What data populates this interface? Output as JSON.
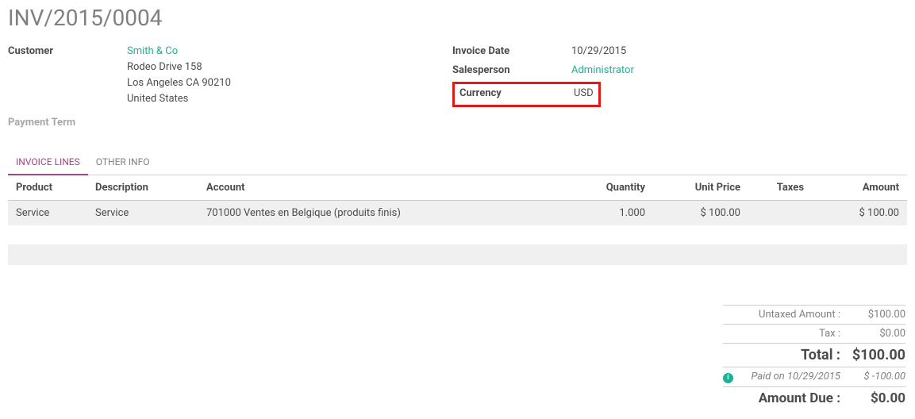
{
  "title": "INV/2015/0004",
  "left": {
    "customer_label": "Customer",
    "customer_name": "Smith & Co",
    "addr1": "Rodeo Drive 158",
    "addr2": "Los Angeles CA 90210",
    "addr3": "United States",
    "payment_term_label": "Payment Term"
  },
  "right": {
    "invoice_date_label": "Invoice Date",
    "invoice_date": "10/29/2015",
    "salesperson_label": "Salesperson",
    "salesperson": "Administrator",
    "currency_label": "Currency",
    "currency": "USD"
  },
  "tabs": {
    "lines": "INVOICE LINES",
    "other": "OTHER INFO"
  },
  "table": {
    "headers": {
      "product": "Product",
      "description": "Description",
      "account": "Account",
      "quantity": "Quantity",
      "unit_price": "Unit Price",
      "taxes": "Taxes",
      "amount": "Amount"
    },
    "rows": [
      {
        "product": "Service",
        "description": "Service",
        "account": "701000 Ventes en Belgique (produits finis)",
        "quantity": "1.000",
        "unit_price": "$ 100.00",
        "taxes": "",
        "amount": "$ 100.00"
      }
    ]
  },
  "totals": {
    "untaxed_label": "Untaxed Amount :",
    "untaxed": "$100.00",
    "tax_label": "Tax :",
    "tax": "$0.00",
    "total_label": "Total :",
    "total": "$100.00",
    "paid_label": "Paid on 10/29/2015",
    "paid": "$ -100.00",
    "due_label": "Amount Due :",
    "due": "$0.00"
  }
}
